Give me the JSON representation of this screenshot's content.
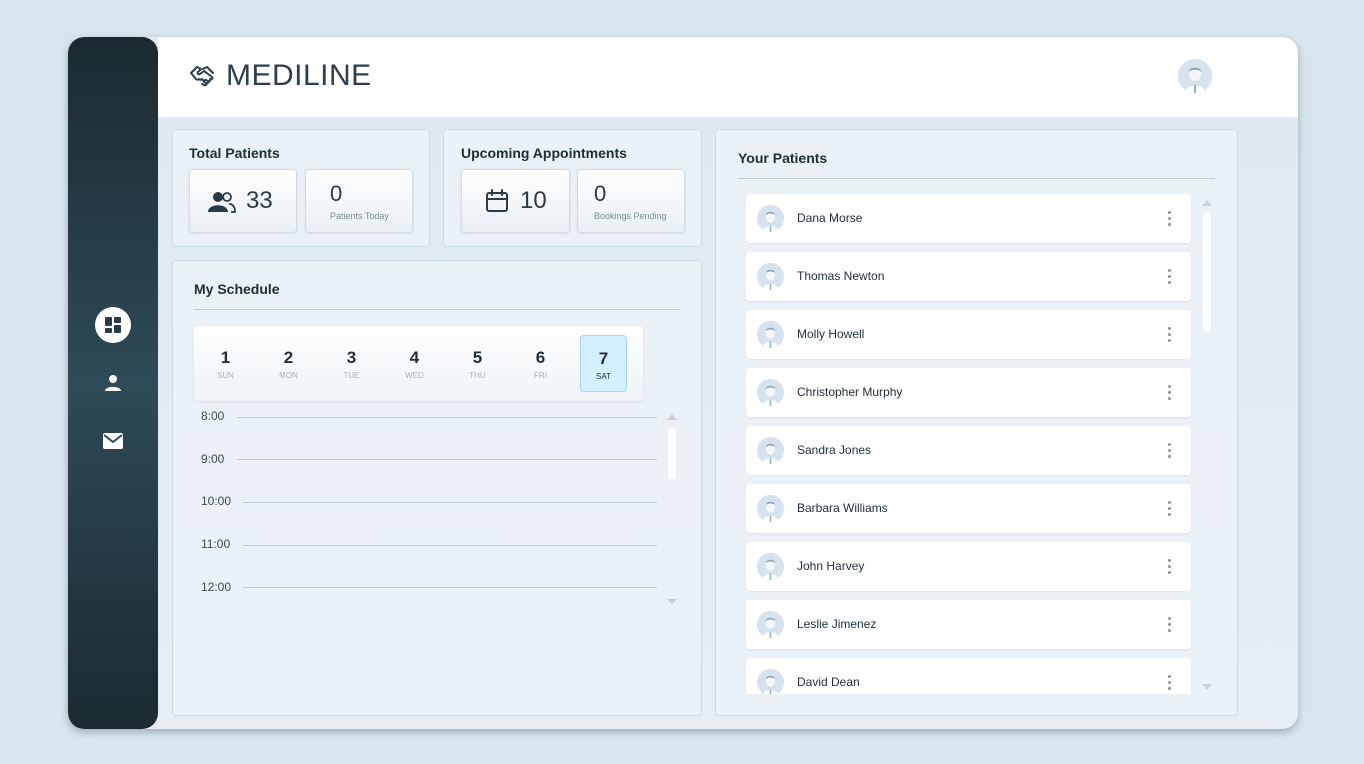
{
  "brand": {
    "name": "MEDILINE",
    "logo_icon": "handshake-icon"
  },
  "sidebar": {
    "items": [
      {
        "icon": "dashboard-icon",
        "active": true
      },
      {
        "icon": "user-icon",
        "active": false
      },
      {
        "icon": "mail-icon",
        "active": false
      }
    ]
  },
  "header": {
    "avatar_icon": "doctor-avatar-icon"
  },
  "total_patients": {
    "title": "Total Patients",
    "total": "33",
    "total_icon": "users-icon",
    "today_value": "0",
    "today_label": "Patients Today"
  },
  "appointments": {
    "title": "Upcoming Appointments",
    "total": "10",
    "total_icon": "calendar-icon",
    "pending_value": "0",
    "pending_label": "Bookings Pending"
  },
  "schedule": {
    "title": "My Schedule",
    "days": [
      {
        "num": "1",
        "name": "SUN"
      },
      {
        "num": "2",
        "name": "MON"
      },
      {
        "num": "3",
        "name": "TUE"
      },
      {
        "num": "4",
        "name": "WED"
      },
      {
        "num": "5",
        "name": "THU"
      },
      {
        "num": "6",
        "name": "FRI"
      },
      {
        "num": "7",
        "name": "SAT"
      }
    ],
    "selected_day": "7",
    "times": [
      "8:00",
      "9:00",
      "10:00",
      "11:00",
      "12:00"
    ]
  },
  "patients": {
    "title": "Your Patients",
    "list": [
      "Dana Morse",
      "Thomas Newton",
      "Molly Howell",
      "Christopher Murphy",
      "Sandra Jones",
      "Barbara Williams",
      "John Harvey",
      "Leslie Jimenez",
      "David Dean"
    ]
  },
  "colors": {
    "sidebar_dark": "#1b2a31",
    "sidebar_mid": "#2f4a58",
    "accent_selected": "#d4efff",
    "text_dark": "#1e2e38"
  }
}
